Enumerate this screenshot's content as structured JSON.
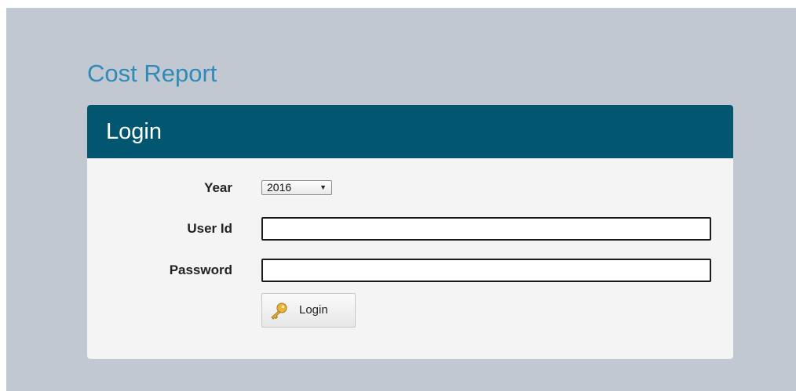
{
  "app": {
    "title": "Cost Report"
  },
  "panel": {
    "heading": "Login"
  },
  "form": {
    "year": {
      "label": "Year",
      "selected": "2016"
    },
    "user_id": {
      "label": "User Id",
      "value": ""
    },
    "password": {
      "label": "Password",
      "value": ""
    },
    "submit": {
      "label": "Login",
      "icon": "key-icon"
    }
  },
  "colors": {
    "page_background": "#c2c8d2",
    "title": "#2f8ab8",
    "panel_header": "#03566f",
    "panel_body": "#f4f4f4"
  }
}
